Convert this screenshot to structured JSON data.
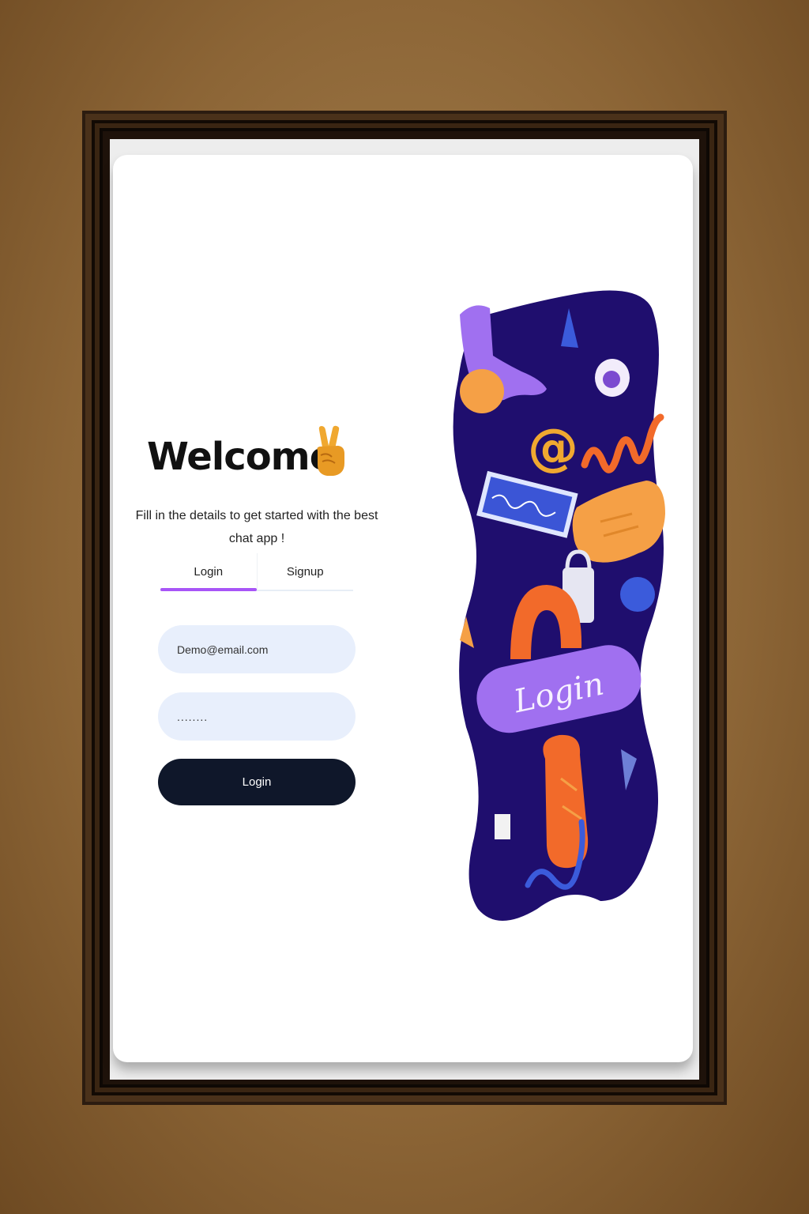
{
  "auth": {
    "title": "Welcome",
    "greeting_icon": "victory-hand-icon",
    "subtitle": "Fill in the details to get started with the best chat app !",
    "tabs": [
      {
        "label": "Login",
        "active": true
      },
      {
        "label": "Signup",
        "active": false
      }
    ],
    "email": {
      "value": "Demo@email.com"
    },
    "password": {
      "value": "........"
    },
    "submit_label": "Login"
  },
  "illustration": {
    "button_label": "Login",
    "symbol": "@"
  },
  "colors": {
    "accent": "#a855f7",
    "input_bg": "#e8effc",
    "button_bg": "#0f172a",
    "illustration_bg": "#1f0e6e"
  }
}
